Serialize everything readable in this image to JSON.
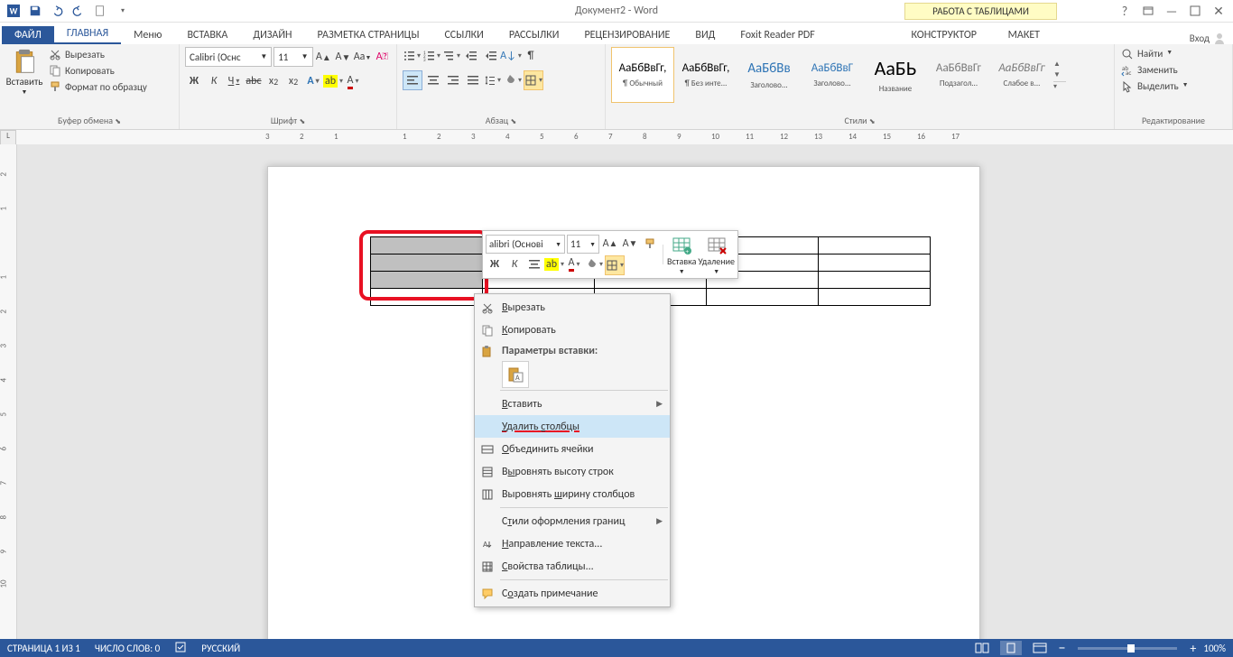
{
  "title": "Документ2 - Word",
  "table_tools": "РАБОТА С ТАБЛИЦАМИ",
  "login": "Вход",
  "tabs": {
    "file": "ФАЙЛ",
    "home": "ГЛАВНАЯ",
    "menu": "Меню",
    "insert": "ВСТАВКА",
    "design": "ДИЗАЙН",
    "layout": "РАЗМЕТКА СТРАНИЦЫ",
    "refs": "ССЫЛКИ",
    "mail": "РАССЫЛКИ",
    "review": "РЕЦЕНЗИРОВАНИЕ",
    "view": "ВИД",
    "foxit": "Foxit Reader PDF",
    "ctx1": "КОНСТРУКТОР",
    "ctx2": "МАКЕТ"
  },
  "clipboard": {
    "paste": "Вставить",
    "cut": "Вырезать",
    "copy": "Копировать",
    "format": "Формат по образцу",
    "label": "Буфер обмена"
  },
  "font": {
    "name": "Calibri (Оснс",
    "size": "11",
    "label": "Шрифт"
  },
  "para": {
    "label": "Абзац"
  },
  "styles": {
    "label": "Стили",
    "items": [
      {
        "prev": "АаБбВвГг,",
        "name": "¶ Обычный",
        "sel": true,
        "color": "#000"
      },
      {
        "prev": "АаБбВвГг,",
        "name": "¶ Без инте...",
        "color": "#000"
      },
      {
        "prev": "АаБбВв",
        "name": "Заголово...",
        "color": "#2e74b5",
        "size": "15px"
      },
      {
        "prev": "АаБбВвГ",
        "name": "Заголово...",
        "color": "#2e74b5",
        "size": "13px"
      },
      {
        "prev": "АаБЬ",
        "name": "Название",
        "color": "#000",
        "size": "22px"
      },
      {
        "prev": "АаБбВвГг",
        "name": "Подзагол...",
        "color": "#777"
      },
      {
        "prev": "АаБбВвГг",
        "name": "Слабое в...",
        "color": "#777",
        "italic": true
      }
    ]
  },
  "editing": {
    "find": "Найти",
    "replace": "Заменить",
    "select": "Выделить",
    "label": "Редактирование"
  },
  "mini": {
    "font": "alibri (Основі",
    "size": "11",
    "insert": "Вставка",
    "delete": "Удаление"
  },
  "context": {
    "cut": "Вырезать",
    "copy": "Копировать",
    "paste_header": "Параметры вставки:",
    "insert": "Вставить",
    "delete_cols": "Удалить столбцы",
    "merge": "Объединить ячейки",
    "dist_rows": "Выровнять высоту строк",
    "dist_cols": "Выровнять ширину столбцов",
    "border_styles": "Стили оформления границ",
    "text_dir": "Направление текста...",
    "table_props": "Свойства таблицы...",
    "comment": "Создать примечание"
  },
  "status": {
    "page": "СТРАНИЦА 1 ИЗ 1",
    "words": "ЧИСЛО СЛОВ: 0",
    "lang": "РУССКИЙ",
    "zoom": "100%"
  },
  "ruler_ticks": [
    "3",
    "2",
    "1",
    "",
    "1",
    "2",
    "3",
    "4",
    "5",
    "6",
    "7",
    "8",
    "9",
    "10",
    "11",
    "12",
    "13",
    "14",
    "15",
    "16",
    "17"
  ]
}
